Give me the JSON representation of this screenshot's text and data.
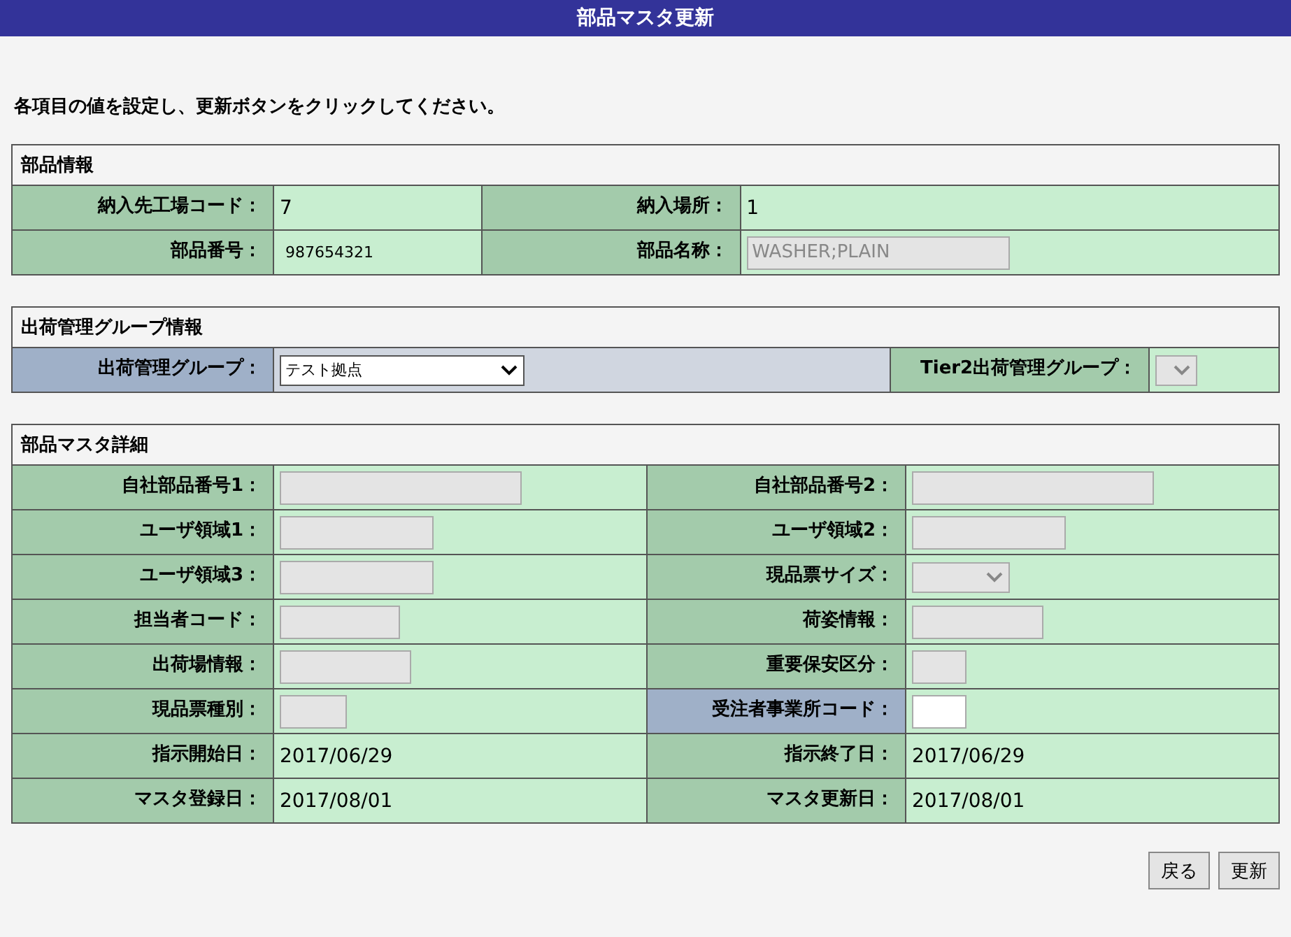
{
  "title": "部品マスタ更新",
  "instruction": "各項目の値を設定し、更新ボタンをクリックしてください。",
  "sections": [
    {
      "heading": "部品情報",
      "rows": [
        [
          {
            "label": "納入先工場コード：",
            "kind": "text",
            "value": "7",
            "required": false
          },
          {
            "label": "納入場所：",
            "kind": "text",
            "value": "1",
            "required": false
          }
        ],
        [
          {
            "label": "部品番号：",
            "kind": "small-text",
            "value": "987654321",
            "required": false
          },
          {
            "label": "部品名称：",
            "kind": "input",
            "value": "WASHER;PLAIN",
            "disabled": true,
            "required": false
          }
        ]
      ]
    },
    {
      "heading": "出荷管理グループ情報",
      "rows": [
        [
          {
            "label": "出荷管理グループ：",
            "kind": "select",
            "value": "テスト拠点",
            "disabled": false,
            "required": true
          },
          {
            "label": "Tier2出荷管理グループ：",
            "kind": "select",
            "disabled": true,
            "required": false
          }
        ]
      ]
    },
    {
      "heading": "部品マスタ詳細",
      "rows": [
        [
          {
            "label": "自社部品番号1：",
            "kind": "input",
            "disabled": true,
            "required": false
          },
          {
            "label": "自社部品番号2：",
            "kind": "input",
            "disabled": true,
            "required": false
          }
        ],
        [
          {
            "label": "ユーザ領域1：",
            "kind": "input",
            "disabled": true,
            "required": false
          },
          {
            "label": "ユーザ領域2：",
            "kind": "input",
            "disabled": true,
            "required": false
          }
        ],
        [
          {
            "label": "ユーザ領域3：",
            "kind": "input",
            "disabled": true,
            "required": false
          },
          {
            "label": "現品票サイズ：",
            "kind": "select",
            "disabled": true,
            "required": false
          }
        ],
        [
          {
            "label": "担当者コード：",
            "kind": "input",
            "disabled": true,
            "required": false
          },
          {
            "label": "荷姿情報：",
            "kind": "input",
            "disabled": true,
            "required": false
          }
        ],
        [
          {
            "label": "出荷場情報：",
            "kind": "input",
            "disabled": true,
            "required": false
          },
          {
            "label": "重要保安区分：",
            "kind": "input",
            "disabled": true,
            "required": false
          }
        ],
        [
          {
            "label": "現品票種別：",
            "kind": "input",
            "disabled": true,
            "required": false
          },
          {
            "label": "受注者事業所コード：",
            "kind": "input",
            "disabled": false,
            "required": true
          }
        ],
        [
          {
            "label": "指示開始日：",
            "kind": "text",
            "value": "2017/06/29",
            "required": false
          },
          {
            "label": "指示終了日：",
            "kind": "text",
            "value": "2017/06/29",
            "required": false
          }
        ],
        [
          {
            "label": "マスタ登録日：",
            "kind": "text",
            "value": "2017/08/01",
            "required": false
          },
          {
            "label": "マスタ更新日：",
            "kind": "text",
            "value": "2017/08/01",
            "required": false
          }
        ]
      ]
    }
  ],
  "buttons": [
    "戻る",
    "更新"
  ]
}
